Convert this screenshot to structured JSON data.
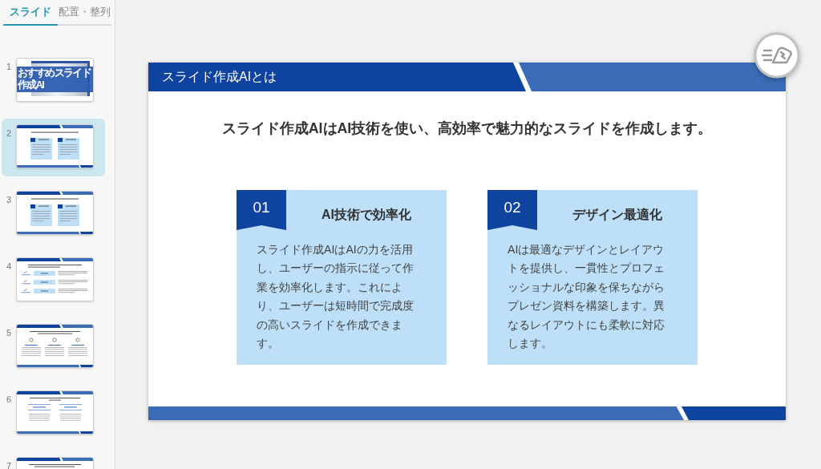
{
  "sidebar": {
    "tabs": [
      {
        "label": "スライド",
        "selected": true
      },
      {
        "label": "配置・整列",
        "selected": false
      }
    ],
    "slides": [
      {
        "number": "1",
        "kind": "title",
        "title": "おすすめスライド作成AI",
        "selected": false
      },
      {
        "number": "2",
        "kind": "two-cards",
        "selected": true
      },
      {
        "number": "3",
        "kind": "two-cards",
        "selected": false
      },
      {
        "number": "4",
        "kind": "three-rows",
        "selected": false
      },
      {
        "number": "5",
        "kind": "three-icons",
        "selected": false
      },
      {
        "number": "6",
        "kind": "two-columns",
        "selected": false
      },
      {
        "number": "7",
        "kind": "text",
        "selected": false
      }
    ]
  },
  "slide": {
    "title": "スライド作成AIとは",
    "lead": "スライド作成AIはAI技術を使い、高効率で魅力的なスライドを作成します。",
    "cards": [
      {
        "number": "01",
        "heading": "AI技術で効率化",
        "body": "スライド作成AIはAIの力を活用し、ユーザーの指示に従って作業を効率化します。これにより、ユーザーは短時間で完成度の高いスライドを作成できます。"
      },
      {
        "number": "02",
        "heading": "デザイン最適化",
        "body": "AIは最適なデザインとレイアウトを提供し、一貫性とプロフェッショナルな印象を保ちながらプレゼン資料を構築します。異なるレイアウトにも柔軟に対応します。"
      }
    ]
  }
}
